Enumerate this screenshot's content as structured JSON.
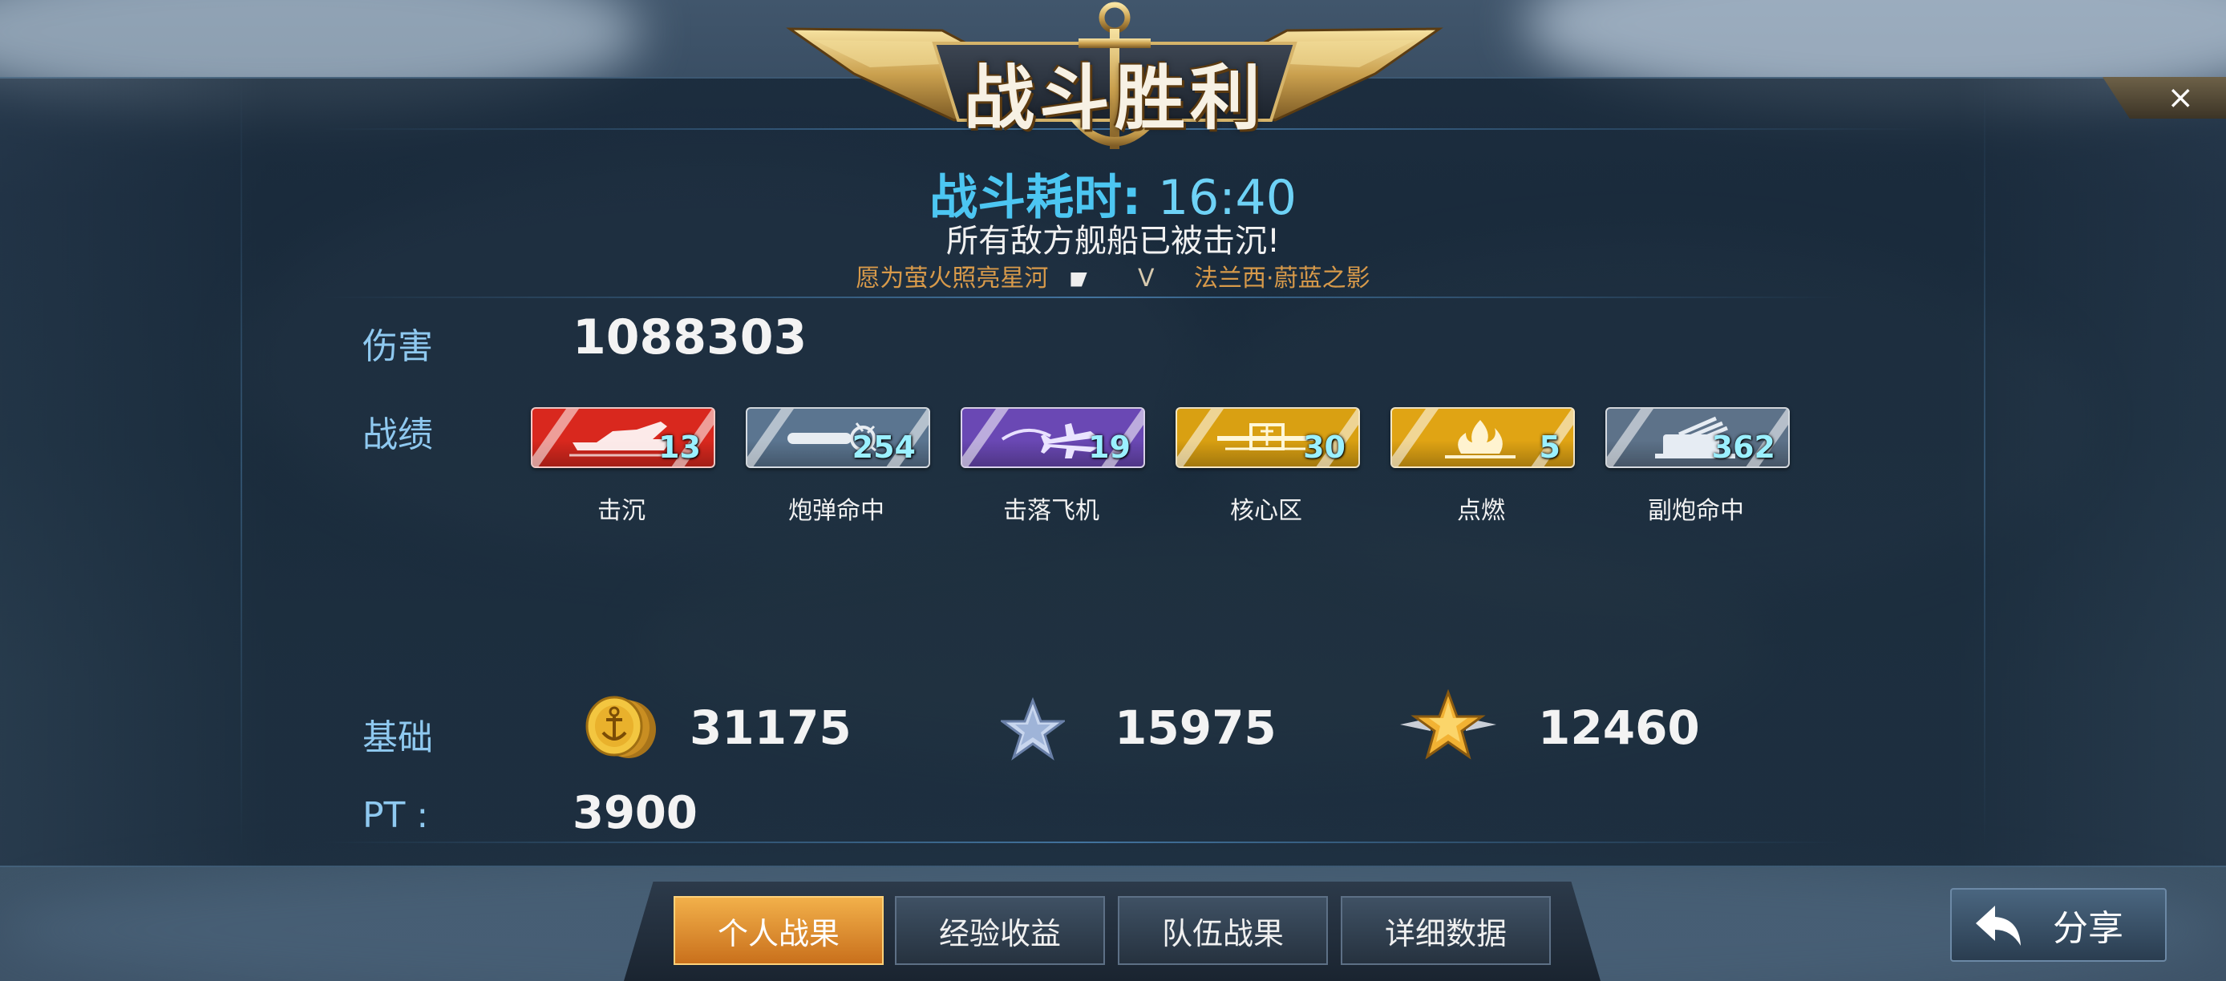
{
  "banner": {
    "title": "战斗胜利"
  },
  "header": {
    "duration_label": "战斗耗时:",
    "duration_value": "16:40",
    "result_message": "所有敌方舰船已被击沉!",
    "player_name": "愿为萤火照亮星河",
    "vs": "V",
    "enemy_name": "法兰西·蔚蓝之影"
  },
  "damage": {
    "label": "伤害",
    "value": "1088303"
  },
  "record": {
    "label": "战绩",
    "items": [
      {
        "caption": "击沉",
        "count": "13",
        "color": "#d9281e",
        "icon": "sinking-ship-icon"
      },
      {
        "caption": "炮弹命中",
        "count": "254",
        "color": "#5b7590",
        "icon": "shell-hit-icon"
      },
      {
        "caption": "击落飞机",
        "count": "19",
        "color": "#6a48b4",
        "icon": "plane-shot-icon"
      },
      {
        "caption": "核心区",
        "count": "30",
        "color": "#d9a012",
        "icon": "citadel-hit-icon"
      },
      {
        "caption": "点燃",
        "count": "5",
        "color": "#e0a414",
        "icon": "fire-icon"
      },
      {
        "caption": "副炮命中",
        "count": "362",
        "color": "#5d7289",
        "icon": "secondary-gun-icon"
      }
    ]
  },
  "base": {
    "label": "基础",
    "gold": "31175",
    "exp": "15975",
    "free_exp": "12460"
  },
  "pt": {
    "label": "PT :",
    "value": "3900"
  },
  "tabs": [
    {
      "label": "个人战果",
      "active": true
    },
    {
      "label": "经验收益",
      "active": false
    },
    {
      "label": "队伍战果",
      "active": false
    },
    {
      "label": "详细数据",
      "active": false
    }
  ],
  "share": {
    "label": "分享"
  },
  "close": {
    "label": "×"
  }
}
